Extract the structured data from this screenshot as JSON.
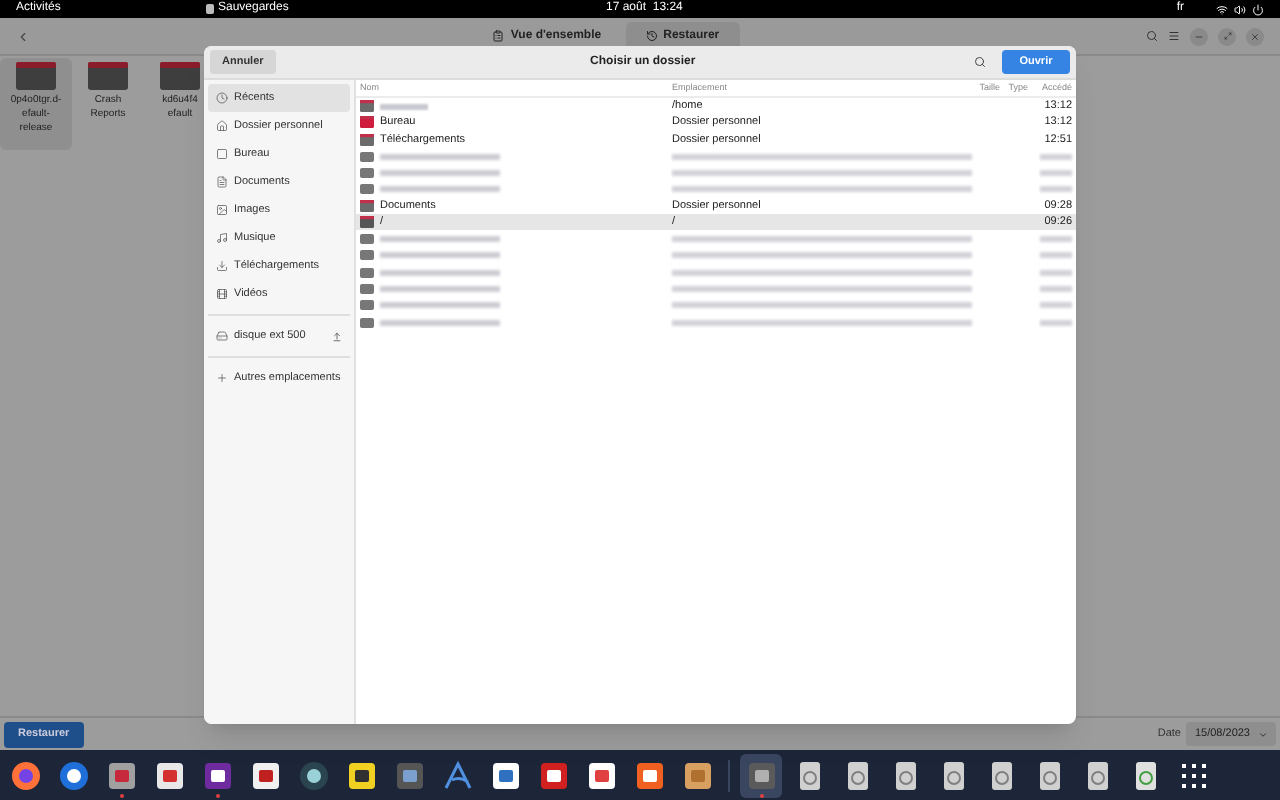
{
  "top_bar": {
    "activities": "Activités",
    "app_name": "Sauvegardes",
    "clock": "17 août  13:24",
    "keyboard": "fr"
  },
  "header": {
    "tabs": [
      {
        "label": "Vue d'ensemble",
        "kind": "overview",
        "selected": false
      },
      {
        "label": "Restaurer",
        "kind": "history",
        "selected": true
      }
    ]
  },
  "folders": [
    {
      "lines": [
        "0p4o0tgr.d-",
        "efault-",
        "release"
      ],
      "selected": true
    },
    {
      "lines": [
        "Crash",
        "Reports"
      ],
      "selected": false
    },
    {
      "lines": [
        "kd6u4f4",
        "efault"
      ],
      "selected": false
    }
  ],
  "bottom_bar": {
    "restore_button": "Restaurer",
    "date_label": "Date",
    "date_value": "15/08/2023"
  },
  "dialog": {
    "cancel": "Annuler",
    "title": "Choisir un dossier",
    "open": "Ouvrir",
    "sidebar": [
      {
        "kind": "recent",
        "label": "Récents",
        "selected": true
      },
      {
        "kind": "home",
        "label": "Dossier personnel",
        "selected": false
      },
      {
        "kind": "desktop",
        "label": "Bureau",
        "selected": false
      },
      {
        "kind": "document",
        "label": "Documents",
        "selected": false
      },
      {
        "kind": "image",
        "label": "Images",
        "selected": false
      },
      {
        "kind": "music",
        "label": "Musique",
        "selected": false
      },
      {
        "kind": "download",
        "label": "Téléchargements",
        "selected": false
      },
      {
        "kind": "video",
        "label": "Vidéos",
        "selected": false
      },
      {
        "kind": "separator"
      },
      {
        "kind": "drive",
        "label": "disque ext 500",
        "selected": false
      },
      {
        "kind": "separator"
      },
      {
        "kind": "other",
        "label": "Autres emplacements",
        "selected": false
      }
    ],
    "columns": [
      "Nom",
      "Emplacement",
      "Taille",
      "Type",
      "Accédé"
    ],
    "rows": [
      {
        "kind": "home",
        "location": "/home",
        "accessed": "13:12",
        "selected": false
      },
      {
        "kind": "desktop",
        "name": "Bureau",
        "location": "Dossier personnel",
        "accessed": "13:12",
        "selected": false
      },
      {
        "kind": "download",
        "name": "Téléchargements",
        "location": "Dossier personnel",
        "accessed": "12:51",
        "selected": false
      },
      {
        "kind": "redacted",
        "selected": false
      },
      {
        "kind": "redacted",
        "selected": false
      },
      {
        "kind": "redacted",
        "selected": false
      },
      {
        "kind": "document",
        "name": "Documents",
        "location": "Dossier personnel",
        "accessed": "09:28",
        "selected": false
      },
      {
        "kind": "folder",
        "name": "/",
        "location": "/",
        "accessed": "09:26",
        "selected": true
      },
      {
        "kind": "redacted",
        "selected": false
      },
      {
        "kind": "redacted",
        "selected": false
      },
      {
        "kind": "redacted",
        "selected": false
      },
      {
        "kind": "redacted",
        "selected": false
      },
      {
        "kind": "redacted",
        "selected": false
      },
      {
        "kind": "redacted",
        "selected": false
      }
    ]
  },
  "dock": [
    {
      "kind": "browser",
      "running": false
    },
    {
      "kind": "mail",
      "running": false
    },
    {
      "kind": "files",
      "running": true
    },
    {
      "kind": "viewer",
      "running": false
    },
    {
      "kind": "tasks",
      "running": true
    },
    {
      "kind": "text",
      "running": false
    },
    {
      "kind": "disk",
      "running": false
    },
    {
      "kind": "notes",
      "running": false
    },
    {
      "kind": "scanner",
      "running": false
    },
    {
      "kind": "vector",
      "running": false
    },
    {
      "kind": "writer",
      "running": false
    },
    {
      "kind": "video",
      "running": false
    },
    {
      "kind": "store",
      "running": false
    },
    {
      "kind": "appstore",
      "running": false
    },
    {
      "kind": "archive",
      "running": false
    },
    {
      "kind": "separator"
    },
    {
      "kind": "backup",
      "running": true
    },
    {
      "kind": "drive",
      "running": false
    },
    {
      "kind": "drive",
      "running": false
    },
    {
      "kind": "drive",
      "running": false
    },
    {
      "kind": "drive",
      "running": false
    },
    {
      "kind": "usb",
      "running": false
    },
    {
      "kind": "drive",
      "running": false
    },
    {
      "kind": "drive",
      "running": false
    },
    {
      "kind": "trash",
      "running": false
    },
    {
      "kind": "grid",
      "running": false
    }
  ]
}
